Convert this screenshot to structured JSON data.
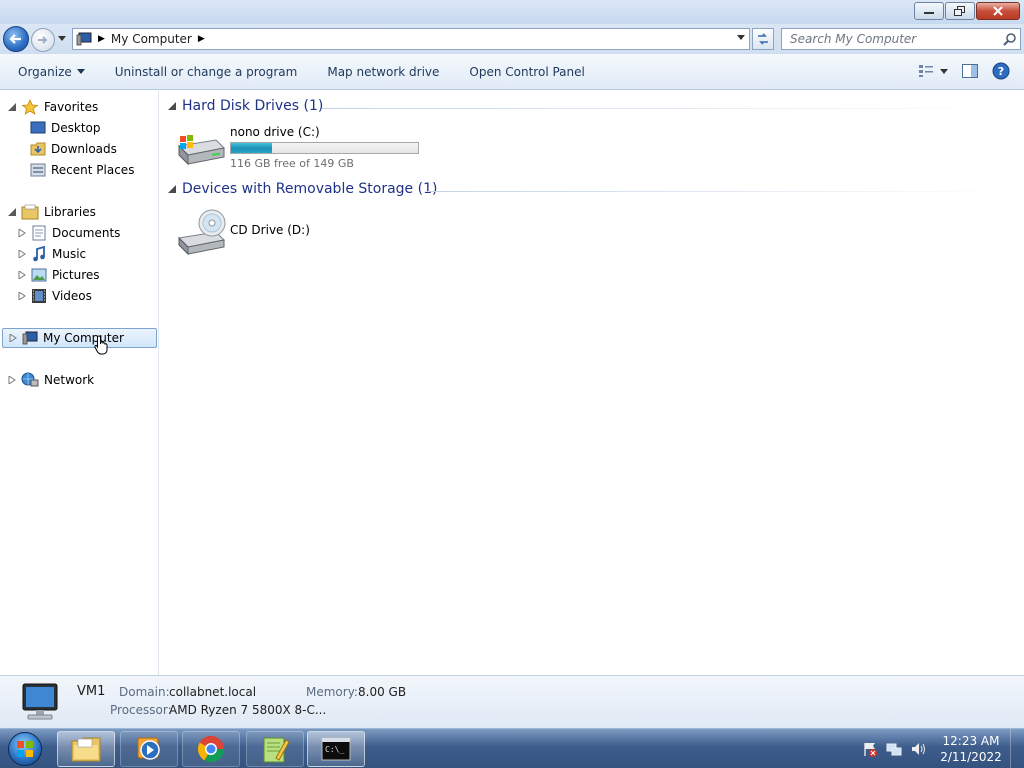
{
  "window": {
    "buttons": [
      "minimize",
      "maximize",
      "close"
    ]
  },
  "address_bar": {
    "crumbs": [
      "My Computer"
    ]
  },
  "search": {
    "placeholder": "Search My Computer"
  },
  "toolbar": {
    "organize": "Organize",
    "uninstall": "Uninstall or change a program",
    "map_drive": "Map network drive",
    "control_panel": "Open Control Panel"
  },
  "nav_pane": {
    "favorites": {
      "label": "Favorites",
      "items": [
        {
          "label": "Desktop",
          "icon": "desktop-icon"
        },
        {
          "label": "Downloads",
          "icon": "downloads-folder-icon"
        },
        {
          "label": "Recent Places",
          "icon": "recent-places-icon"
        }
      ]
    },
    "libraries": {
      "label": "Libraries",
      "items": [
        {
          "label": "Documents",
          "icon": "documents-icon"
        },
        {
          "label": "Music",
          "icon": "music-icon"
        },
        {
          "label": "Pictures",
          "icon": "pictures-icon"
        },
        {
          "label": "Videos",
          "icon": "videos-icon"
        }
      ]
    },
    "computer": {
      "label": "My Computer",
      "selected": true
    },
    "network": {
      "label": "Network"
    }
  },
  "content": {
    "groups": [
      {
        "title": "Hard Disk Drives (1)",
        "drives": [
          {
            "name": "nono drive (C:)",
            "free_text": "116 GB free of 149 GB",
            "used_fraction": 0.22
          }
        ]
      },
      {
        "title": "Devices with Removable Storage (1)",
        "drives": [
          {
            "name": "CD Drive (D:)"
          }
        ]
      }
    ]
  },
  "details": {
    "name": "VM1",
    "domain_label": "Domain:",
    "domain": "collabnet.local",
    "memory_label": "Memory:",
    "memory": "8.00 GB",
    "processor_label": "Processor:",
    "processor": "AMD Ryzen 7 5800X 8-C..."
  },
  "taskbar": {
    "apps": [
      "file-explorer",
      "media-player",
      "chrome",
      "notepad-plus-plus",
      "command-prompt"
    ],
    "time": "12:23 AM",
    "date": "2/11/2022"
  },
  "colors": {
    "nav_text": "#1e395b",
    "group_header": "#1e3287",
    "drive_bar": "#26a6c8",
    "taskbar": "#3e5d8c"
  }
}
